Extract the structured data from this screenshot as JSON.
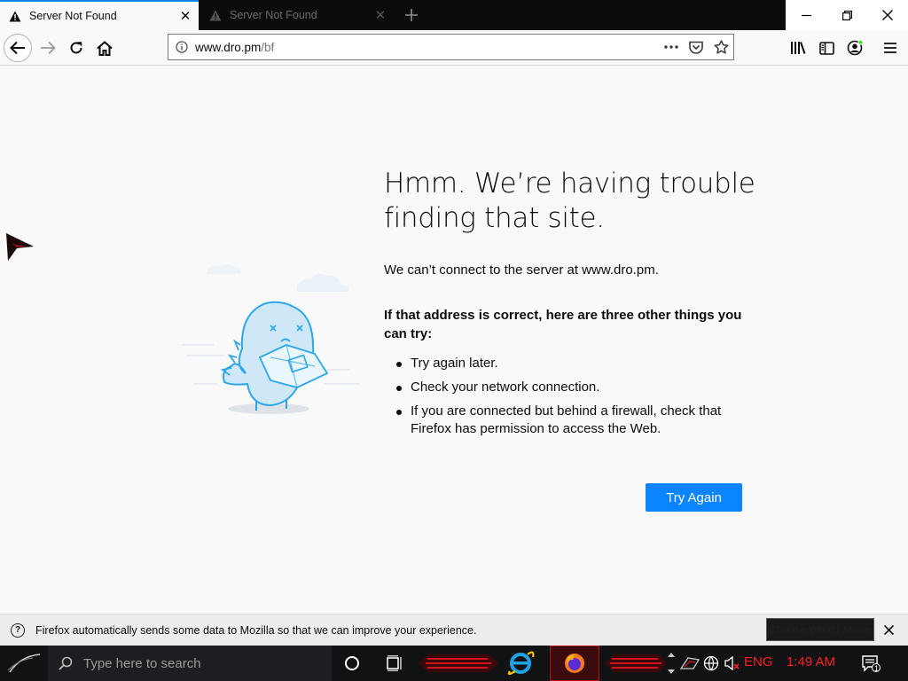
{
  "tabs": [
    {
      "title": "Server Not Found",
      "icon": "warning-icon",
      "active": true
    },
    {
      "title": "Server Not Found",
      "icon": "warning-icon",
      "active": false
    }
  ],
  "toolbar": {
    "url_host": "www.dro.pm",
    "url_path": "/bf"
  },
  "error": {
    "title": "Hmm. We’re having trouble finding that site.",
    "description": "We can’t connect to the server at www.dro.pm.",
    "tips_heading": "If that address is correct, here are three other things you can try:",
    "tips": [
      "Try again later.",
      "Check your network connection.",
      "If you are connected but behind a firewall, check that Firefox has permission to access the Web."
    ],
    "button_label": "Try Again"
  },
  "notification": {
    "message": "Firefox automatically sends some data to Mozilla so that we can improve your experience.",
    "button_label": "Choose What I Share"
  },
  "taskbar": {
    "search_placeholder": "Type here to search",
    "language": "ENG",
    "time": "1:49 AM",
    "notification_count": "1"
  },
  "colors": {
    "accent": "#0a84ff",
    "tray_text": "#ff2020"
  }
}
